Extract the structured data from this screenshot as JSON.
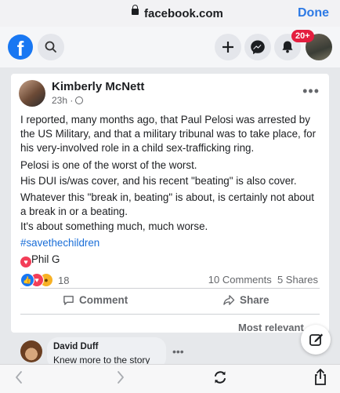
{
  "browser": {
    "url": "facebook.com",
    "done_label": "Done"
  },
  "fb_header": {
    "logo_glyph": "f",
    "notification_badge": "20+",
    "brand_color": "#1877f2"
  },
  "post": {
    "author": "Kimberly McNett",
    "time": "23h ·",
    "paragraphs": [
      "I reported, many months ago, that Paul Pelosi was arrested by the US Military, and that a military tribunal was to take place, for his very-involved role in a child sex-trafficking ring.",
      "Pelosi is one of the worst of the worst.",
      "His DUI is/was cover, and his recent \"beating\" is also cover.",
      "Whatever this \"break in, beating\" is about, is certainly not about a break in or a beating.",
      "It's about something much, much worse."
    ],
    "hashtag": "#savethechildren",
    "reacted_by": "Phil G",
    "reaction_count": "18",
    "comments": "10 Comments",
    "shares": "5 Shares",
    "comment_label": "Comment",
    "share_label": "Share"
  },
  "comments_section": {
    "sort_label": "Most relevant",
    "first_comment": {
      "author": "David Duff",
      "text": "Knew more to the story"
    }
  },
  "bottom_toolbar": {
    "back_glyph": "<",
    "forward_glyph": ">"
  }
}
